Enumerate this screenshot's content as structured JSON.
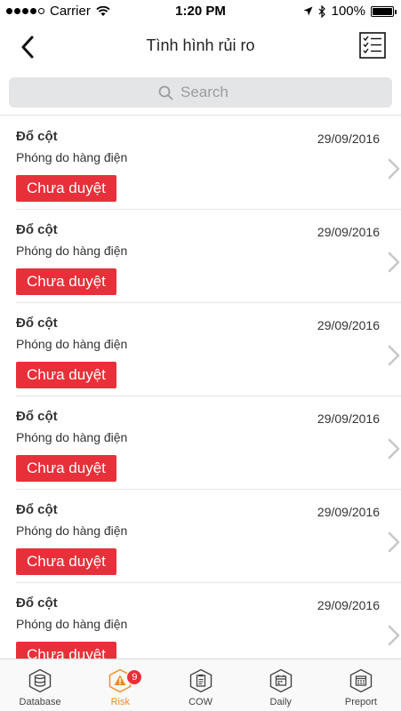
{
  "status_bar": {
    "carrier": "Carrier",
    "time": "1:20 PM",
    "battery": "100%"
  },
  "nav": {
    "title": "Tình hình rủi ro"
  },
  "search": {
    "placeholder": "Search"
  },
  "items": [
    {
      "title": "Đổ cột",
      "date": "29/09/2016",
      "subtitle": "Phóng do hàng điện",
      "status": "Chưa duyệt"
    },
    {
      "title": "Đổ cột",
      "date": "29/09/2016",
      "subtitle": "Phóng do hàng điện",
      "status": "Chưa duyệt"
    },
    {
      "title": "Đổ cột",
      "date": "29/09/2016",
      "subtitle": "Phóng do hàng điện",
      "status": "Chưa duyệt"
    },
    {
      "title": "Đổ cột",
      "date": "29/09/2016",
      "subtitle": "Phóng do hàng điện",
      "status": "Chưa duyệt"
    },
    {
      "title": "Đổ cột",
      "date": "29/09/2016",
      "subtitle": "Phóng do hàng điện",
      "status": "Chưa duyệt"
    },
    {
      "title": "Đổ cột",
      "date": "29/09/2016",
      "subtitle": "Phóng do hàng điện",
      "status": "Chưa duyệt"
    }
  ],
  "tabs": [
    {
      "label": "Database",
      "icon": "database-icon"
    },
    {
      "label": "Risk",
      "icon": "warning-icon",
      "badge": "9",
      "active": true
    },
    {
      "label": "COW",
      "icon": "clipboard-icon"
    },
    {
      "label": "Daily",
      "icon": "calendar-icon"
    },
    {
      "label": "Preport",
      "icon": "report-icon"
    }
  ],
  "colors": {
    "status_badge": "#e8303a",
    "active_tab": "#f08a24",
    "search_bg": "#e4e5e7"
  }
}
